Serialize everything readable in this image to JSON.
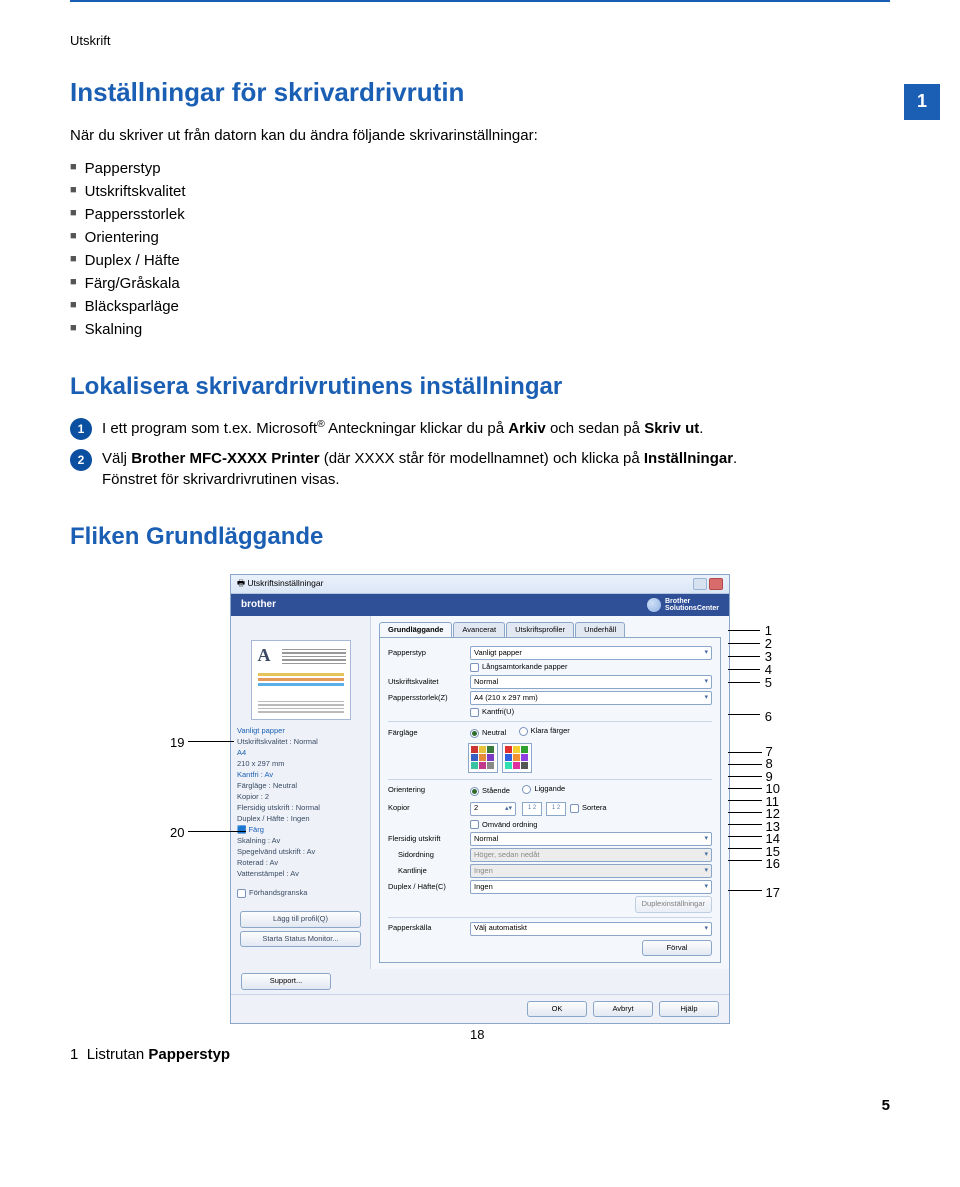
{
  "breadcrumb": "Utskrift",
  "side_tab": "1",
  "h1": "Inställningar för skrivardrivrutin",
  "intro": "När du skriver ut från datorn kan du ändra följande skrivarinställningar:",
  "bullets": [
    "Papperstyp",
    "Utskriftskvalitet",
    "Pappersstorlek",
    "Orientering",
    "Duplex / Häfte",
    "Färg/Gråskala",
    "Bläcksparläge",
    "Skalning"
  ],
  "h2_1": "Lokalisera skrivardrivrutinens inställningar",
  "steps": [
    {
      "n": "1",
      "pre": "I ett program som t.ex. Microsoft",
      "sup": "®",
      "mid": " Anteckningar klickar du på ",
      "b1": "Arkiv",
      "mid2": " och sedan på ",
      "b2": "Skriv ut",
      "end": "."
    },
    {
      "n": "2",
      "pre": "Välj ",
      "b1": "Brother MFC-XXXX Printer",
      "mid": " (där XXXX står för modellnamnet) och klicka på ",
      "b2": "Inställningar",
      "end": ".\nFönstret för skrivardrivrutinen visas."
    }
  ],
  "h2_2": "Fliken Grundläggande",
  "shot": {
    "title": "Utskriftsinställningar",
    "brand": "brother",
    "solutions": "Brother\nSolutionsCenter",
    "tabs": [
      "Grundläggande",
      "Avancerat",
      "Utskriftsprofiler",
      "Underhåll"
    ],
    "left_info": [
      {
        "t": "Vanligt papper",
        "c": "blue"
      },
      {
        "t": "Utskriftskvalitet : Normal"
      },
      {
        "t": "A4",
        "c": "blue"
      },
      {
        "t": "210 x 297 mm"
      },
      {
        "t": "Kantfri : Av",
        "c": "blue"
      },
      {
        "t": "Färgläge : Neutral"
      },
      {
        "t": "Kopior : 2"
      },
      {
        "t": "Flersidig utskrift : Normal"
      },
      {
        "t": "Duplex / Häfte : Ingen"
      },
      {
        "t": " "
      },
      {
        "t": "Färg",
        "c": "blue"
      },
      {
        "t": "Skalning : Av"
      },
      {
        "t": "Spegelvänd utskrift : Av"
      },
      {
        "t": "Roterad : Av"
      },
      {
        "t": "Vattenstämpel : Av"
      }
    ],
    "left_buttons": [
      "Lägg till profil(Q)",
      "Starta Status Monitor..."
    ],
    "forhands": "Förhandsgranska",
    "support": "Support...",
    "rows": {
      "papperstyp": {
        "label": "Papperstyp",
        "value": "Vanligt papper"
      },
      "langsam": "Långsamtorkande papper",
      "kvalitet": {
        "label": "Utskriftskvalitet",
        "value": "Normal"
      },
      "storlek": {
        "label": "Pappersstorlek(Z)",
        "value": "A4 (210 x 297 mm)"
      },
      "kantfri": "Kantfri(U)",
      "farglage_label": "Färgläge",
      "farglage_opts": [
        "Neutral",
        "Klara färger"
      ],
      "orient_label": "Orientering",
      "orient_opts": [
        "Stående",
        "Liggande"
      ],
      "kopior": {
        "label": "Kopior",
        "value": "2"
      },
      "sortera": "Sortera",
      "omvand": "Omvänd ordning",
      "flersidig": {
        "label": "Flersidig utskrift",
        "value": "Normal"
      },
      "sidordning": {
        "label": "Sidordning",
        "value": "Höger, sedan nedåt"
      },
      "kantlinje": {
        "label": "Kantlinje",
        "value": "Ingen"
      },
      "duplex": {
        "label": "Duplex / Häfte(C)",
        "value": "Ingen"
      },
      "duplexinst": "Duplexinställningar",
      "papperskalla": {
        "label": "Papperskälla",
        "value": "Välj automatiskt"
      }
    },
    "footer": [
      "OK",
      "Avbryt",
      "Hjälp"
    ],
    "forval": "Förval"
  },
  "callouts_right": [
    "1",
    "2",
    "3",
    "4",
    "5",
    "6",
    "7",
    "8",
    "9",
    "10",
    "11",
    "12",
    "13",
    "14",
    "15",
    "16",
    "17"
  ],
  "callouts_left": [
    "19",
    "20"
  ],
  "callout_bottom": "18",
  "caption": {
    "n": "1",
    "pre": "Listrutan ",
    "b": "Papperstyp"
  },
  "page_num": "5"
}
